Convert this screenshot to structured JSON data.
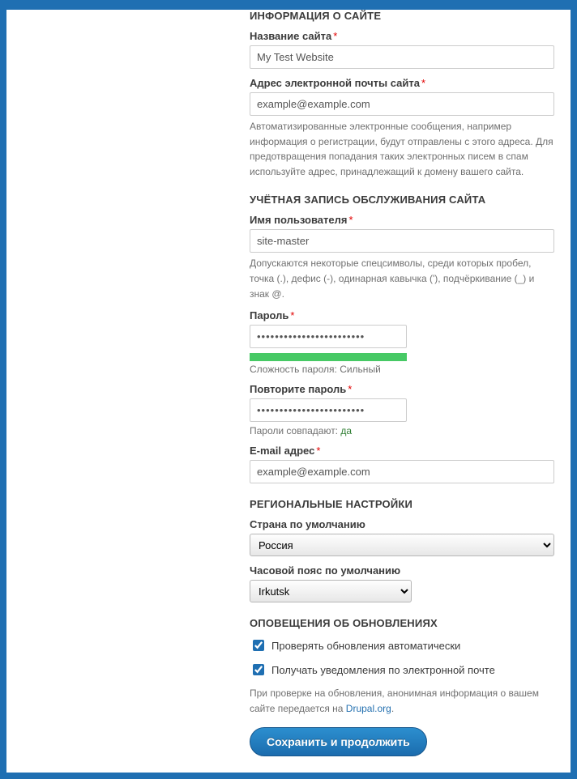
{
  "sections": {
    "site_info": "ИНФОРМАЦИЯ О САЙТЕ",
    "account": "УЧЁТНАЯ ЗАПИСЬ ОБСЛУЖИВАНИЯ САЙТА",
    "regional": "РЕГИОНАЛЬНЫЕ НАСТРОЙКИ",
    "updates": "ОПОВЕЩЕНИЯ ОБ ОБНОВЛЕНИЯХ"
  },
  "site": {
    "name_label": "Название сайта",
    "name_value": "My Test Website",
    "email_label": "Адрес электронной почты сайта",
    "email_value": "example@example.com",
    "email_desc": "Автоматизированные электронные сообщения, например информация о регистрации, будут отправлены с этого адреса. Для предотвращения попадания таких электронных писем в спам используйте адрес, принадлежащий к домену вашего сайта."
  },
  "account": {
    "user_label": "Имя пользователя",
    "user_value": "site-master",
    "user_desc": "Допускаются некоторые спецсимволы, среди которых пробел, точка (.), дефис (-), одинарная кавычка ('), подчёркивание (_) и знак @.",
    "pwd_label": "Пароль",
    "pwd_value": "••••••••••••••••••••••••",
    "strength_label": "Сложность пароля:",
    "strength_value": "Сильный",
    "pwd2_label": "Повторите пароль",
    "pwd2_value": "••••••••••••••••••••••••",
    "match_label": "Пароли совпадают:",
    "match_value": "да",
    "email_label": "E-mail адрес",
    "email_value": "example@example.com"
  },
  "regional": {
    "country_label": "Страна по умолчанию",
    "country_value": "Россия",
    "tz_label": "Часовой пояс по умолчанию",
    "tz_value": "Irkutsk"
  },
  "updates": {
    "check_label": "Проверять обновления автоматически",
    "email_label": "Получать уведомления по электронной почте",
    "desc_pre": "При проверке на обновления, анонимная информация о вашем сайте передается на ",
    "link_text": "Drupal.org",
    "desc_post": "."
  },
  "submit": "Сохранить и продолжить"
}
